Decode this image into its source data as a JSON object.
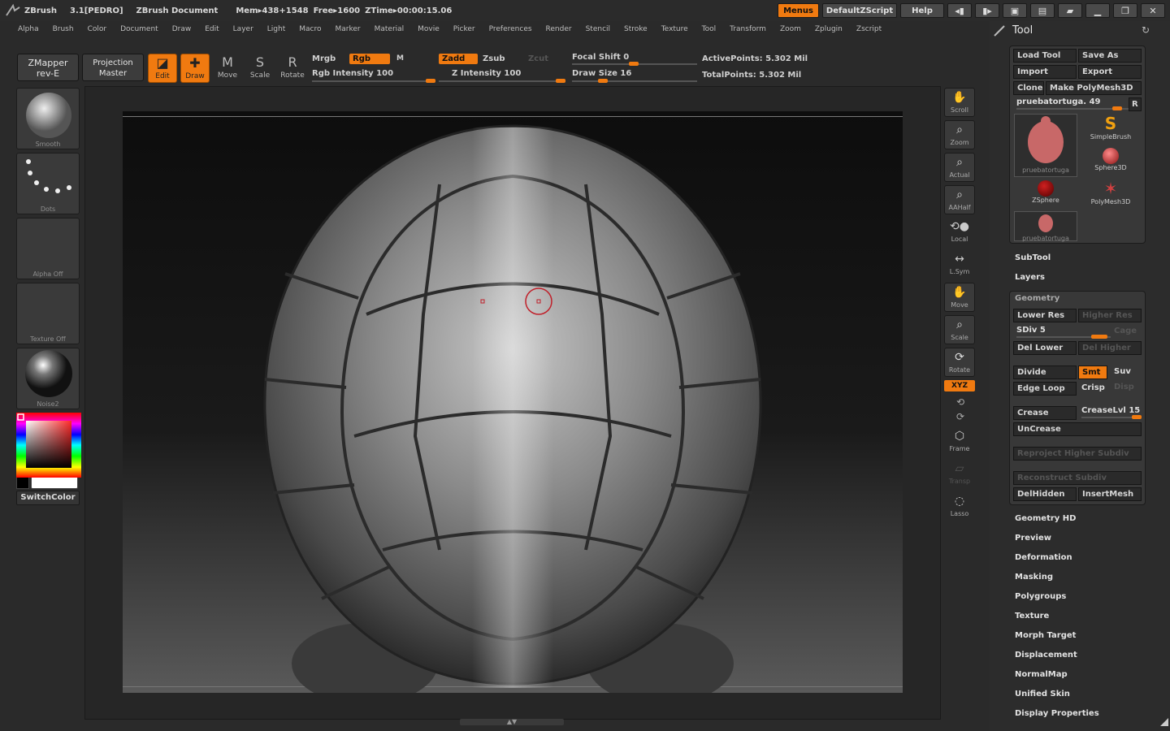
{
  "titlebar": {
    "app": "ZBrush",
    "version": "3.1[PEDRO]",
    "document": "ZBrush Document",
    "mem": "Mem▸438+1548",
    "free": "Free▸1600",
    "ztime": "ZTime▸00:00:15.06",
    "menus_label": "Menus",
    "script_label": "DefaultZScript",
    "help_label": "Help"
  },
  "menus": [
    "Alpha",
    "Brush",
    "Color",
    "Document",
    "Draw",
    "Edit",
    "Layer",
    "Light",
    "Macro",
    "Marker",
    "Material",
    "Movie",
    "Picker",
    "Preferences",
    "Render",
    "Stencil",
    "Stroke",
    "Texture",
    "Tool",
    "Transform",
    "Zoom",
    "Zplugin",
    "Zscript"
  ],
  "top": {
    "zmapper_line1": "ZMapper",
    "zmapper_line2": "rev-E",
    "projection_line1": "Projection",
    "projection_line2": "Master",
    "edit": "Edit",
    "draw": "Draw",
    "move": "Move",
    "scale": "Scale",
    "rotate": "Rotate",
    "mrgb": "Mrgb",
    "rgb": "Rgb",
    "m": "M",
    "rgb_intensity": "Rgb Intensity 100",
    "zadd": "Zadd",
    "zsub": "Zsub",
    "zcut": "Zcut",
    "z_intensity": "Z Intensity 100",
    "focal_shift": "Focal Shift 0",
    "draw_size": "Draw Size 16",
    "active_points": "ActivePoints: 5.302 Mil",
    "total_points": "TotalPoints: 5.302 Mil"
  },
  "left": {
    "brush_label": "Smooth",
    "stroke_label": "Dots",
    "alpha_label": "Alpha Off",
    "texture_label": "Texture Off",
    "material_label": "Noise2",
    "switch_color": "SwitchColor"
  },
  "right_shelf": {
    "scroll": "Scroll",
    "zoom": "Zoom",
    "actual": "Actual",
    "aahalf": "AAHalf",
    "local": "Local",
    "lsym": "L.Sym",
    "move": "Move",
    "scale": "Scale",
    "rotate": "Rotate",
    "xyz": "XYZ",
    "frame": "Frame",
    "transp": "Transp",
    "lasso": "Lasso"
  },
  "tool": {
    "title": "Tool",
    "load_tool": "Load Tool",
    "save_as": "Save As",
    "import": "Import",
    "export": "Export",
    "clone": "Clone",
    "make_polymesh": "Make PolyMesh3D",
    "current_tool": "pruebatortuga. 49",
    "r": "R",
    "thumbs": [
      "pruebatortuga",
      "SimpleBrush",
      "Sphere3D",
      "ZSphere",
      "PolyMesh3D",
      "pruebatortuga"
    ],
    "subtool": "SubTool",
    "layers": "Layers",
    "geometry": "Geometry",
    "lower_res": "Lower Res",
    "higher_res": "Higher Res",
    "sdiv": "SDiv 5",
    "cage": "Cage",
    "del_lower": "Del Lower",
    "del_higher": "Del Higher",
    "divide": "Divide",
    "smt": "Smt",
    "suv": "Suv",
    "edge_loop": "Edge Loop",
    "crisp": "Crisp",
    "disp": "Disp",
    "crease": "Crease",
    "crease_lvl": "CreaseLvl 15",
    "uncrease": "UnCrease",
    "reproject": "Reproject Higher Subdiv",
    "reconstruct": "Reconstruct Subdiv",
    "delhidden": "DelHidden",
    "insertmesh": "InsertMesh",
    "sections": [
      "Geometry HD",
      "Preview",
      "Deformation",
      "Masking",
      "Polygroups",
      "Texture",
      "Morph Target",
      "Displacement",
      "NormalMap",
      "Unified Skin",
      "Display Properties"
    ]
  },
  "colors": {
    "accent": "#f07a10",
    "background": "#2a2a2a",
    "panel": "#383838"
  }
}
